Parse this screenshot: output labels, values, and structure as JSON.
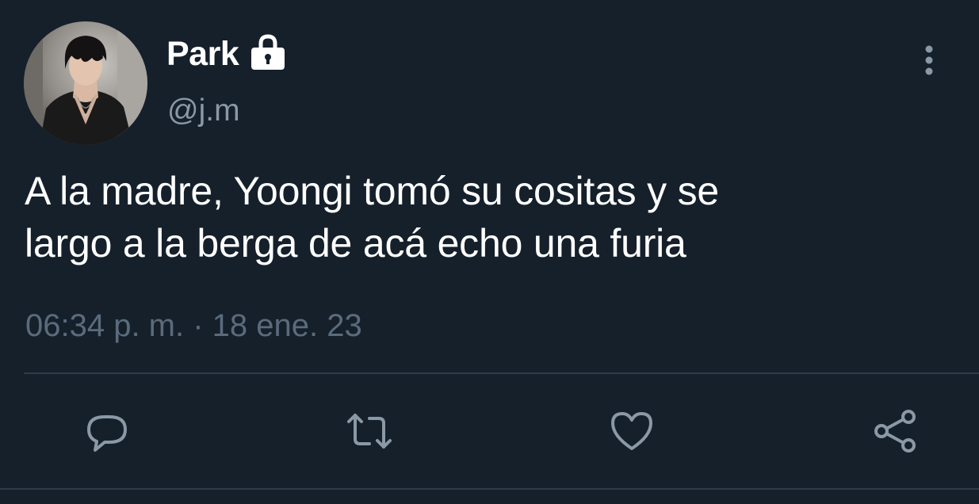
{
  "user": {
    "display_name": "Park",
    "handle": "@j.m",
    "protected": true
  },
  "tweet": {
    "text_line1": "A la madre, Yoongi tomó su cositas y se",
    "text_line2": "largo a la berga de acá echo una furia",
    "timestamp": "06:34 p. m. · 18 ene. 23"
  },
  "icons": {
    "lock": "lock-icon",
    "more": "more-vertical-icon",
    "reply": "reply-icon",
    "retweet": "retweet-icon",
    "like": "heart-icon",
    "share": "share-icon"
  },
  "colors": {
    "background": "#15202b",
    "text_primary": "#ffffff",
    "text_secondary": "#8b98a5",
    "timestamp": "#5b6b7c",
    "icon": "#8b98a5",
    "divider": "#2f3b47"
  }
}
